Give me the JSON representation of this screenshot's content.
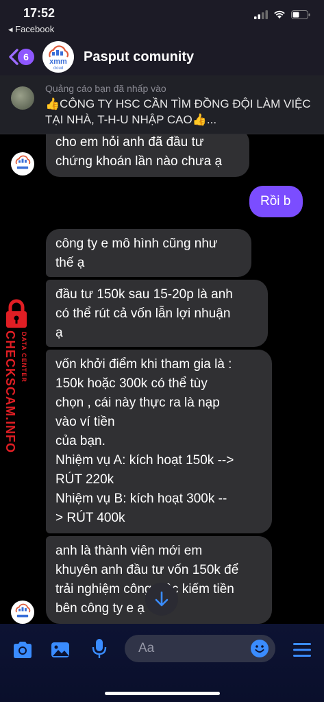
{
  "status_bar": {
    "time": "17:52",
    "back_app": "◂ Facebook"
  },
  "header": {
    "back_badge": "6",
    "title": "Pasput comunity",
    "avatar_text": "xmm",
    "avatar_sub": "cloud"
  },
  "ad": {
    "label": "Quảng cáo bạn đã nhấp vào",
    "text": "👍CÔNG TY HSC CẦN TÌM ĐỒNG ĐỘI LÀM VIỆC TẠI NHÀ, T-H-U NHẬP CAO👍..."
  },
  "messages": [
    {
      "direction": "in",
      "text": "cho em hỏi anh đã đầu tư\nchứng khoán lần nào chưa ạ"
    },
    {
      "direction": "out",
      "text": "Rồi b"
    },
    {
      "direction": "in",
      "text": "công ty e mô hình cũng như\nthế ạ"
    },
    {
      "direction": "in",
      "text": "đầu tư 150k sau 15-20p là anh\ncó thể rút cả vốn lẫn lợi nhuận\nạ"
    },
    {
      "direction": "in",
      "text": "vốn khởi điểm khi tham gia là :\n150k hoặc 300k có thể tùy\nchọn , cái này thực ra là nạp\nvào ví tiền\ncủa bạn.\nNhiệm vụ A: kích hoạt 150k -->\nRÚT 220k\nNhiệm vụ B: kích hoạt 300k --\n> RÚT 400k"
    },
    {
      "direction": "in",
      "text": "anh là thành viên mới em\nkhuyên anh đầu tư vốn 150k để\ntrải nghiệm công việc kiếm tiền\nbên công ty e ạ"
    }
  ],
  "watermark": {
    "main": "CHECKSCAM.INFO",
    "sub": "DATA CENTER"
  },
  "composer": {
    "placeholder": "Aa"
  },
  "colors": {
    "accent": "#7b4dff",
    "badge": "#8e57ff",
    "icon_blue": "#3a8cff",
    "bubble_in": "#303033",
    "watermark": "#e01e24"
  },
  "icons": [
    "camera-icon",
    "gallery-icon",
    "microphone-icon",
    "emoji-icon",
    "menu-icon",
    "chevron-down-icon",
    "lock-icon"
  ]
}
